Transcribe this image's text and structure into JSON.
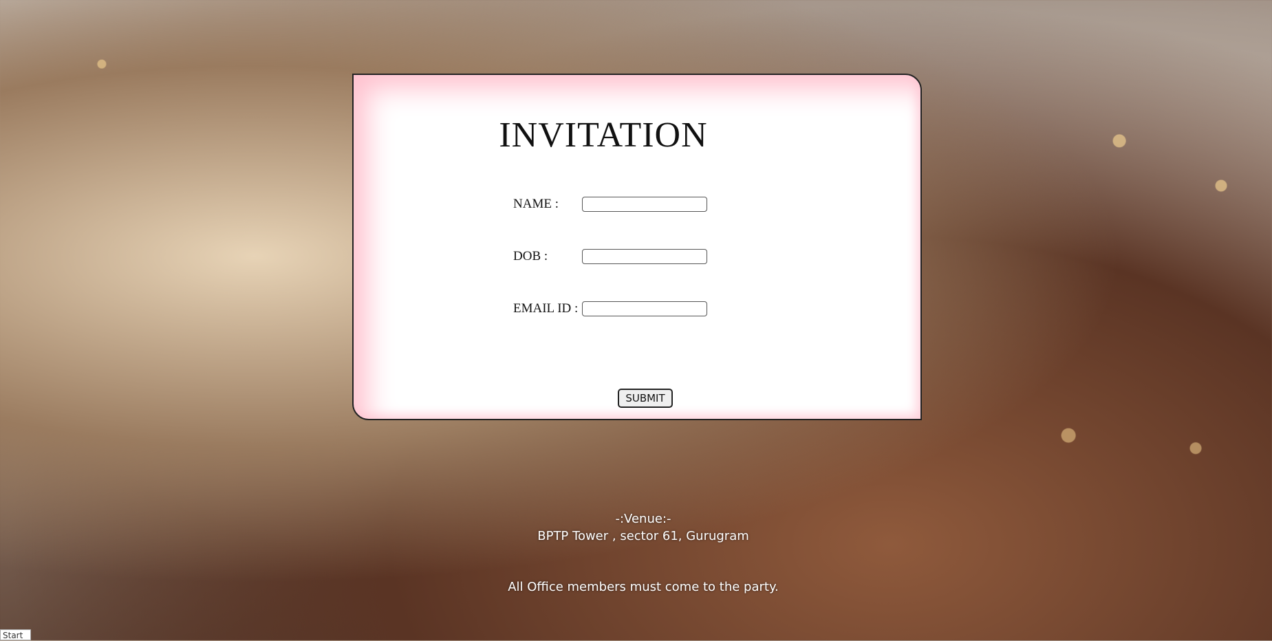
{
  "card": {
    "title": "INVITATION",
    "fields": {
      "name_label": "NAME :",
      "name_value": "",
      "dob_label": "DOB :",
      "dob_value": "",
      "email_label": "EMAIL ID :",
      "email_value": ""
    },
    "submit_label": "SUBMIT"
  },
  "venue": {
    "heading": "-:Venue:-",
    "address": "BPTP Tower , sector 61, Gurugram",
    "note": "All Office members must come to the party."
  },
  "taskbar": {
    "start_label": "Start"
  },
  "colors": {
    "card_glow": "#ffc2cf",
    "card_bg": "#ffffff"
  }
}
